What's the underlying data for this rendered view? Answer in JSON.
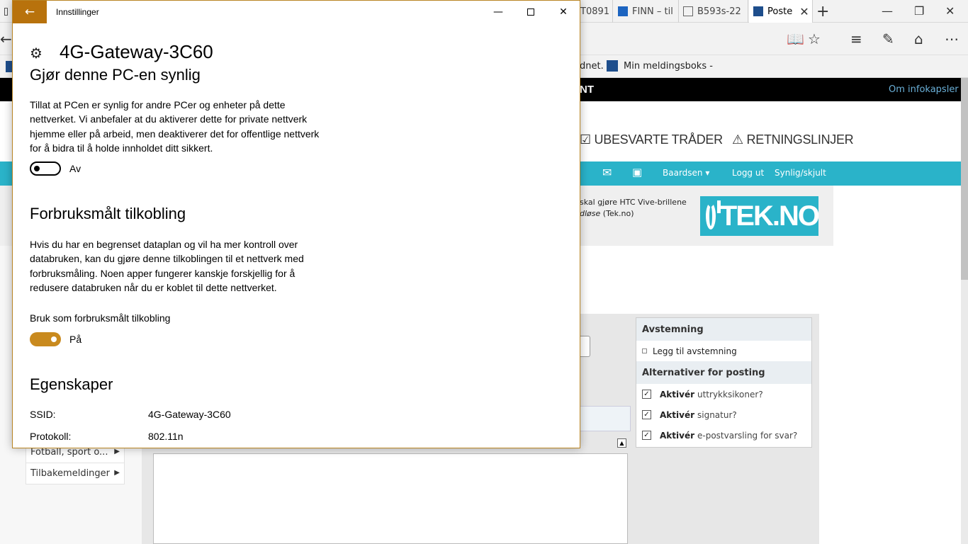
{
  "browser": {
    "tabs": [
      {
        "label": "T0891"
      },
      {
        "label": "FINN – til"
      },
      {
        "label": "B593s-22"
      },
      {
        "label": "Poste"
      }
    ],
    "favorites": [
      {
        "label": "dnet."
      },
      {
        "label": "Min meldingsboks -"
      }
    ]
  },
  "page": {
    "blackbar_text": "NT",
    "info_link": "Om infokapsler",
    "header_links": [
      {
        "label": "UBESVARTE TRÅDER"
      },
      {
        "label": "RETNINGSLINJER"
      }
    ],
    "user_menu": "Baardsen",
    "logout": "Logg ut",
    "visibility": "Synlig/skjult",
    "news_line1": "skal gjøre HTC Vive-brillene",
    "news_line2_italic": "dløse",
    "news_line2_rest": " (Tek.no)",
    "logo_text": "TEK.NO",
    "poll_header": "Avstemning",
    "poll_add": "Legg til avstemning",
    "options_header": "Alternativer for posting",
    "options": [
      {
        "bold": "Aktivér",
        "rest": "uttrykksikoner?"
      },
      {
        "bold": "Aktivér",
        "rest": "signatur?"
      },
      {
        "bold": "Aktivér",
        "rest": "e-postvarsling for svar?"
      }
    ],
    "left_nav": [
      {
        "label": "Fotball, sport o..."
      },
      {
        "label": "Tilbakemeldinger"
      }
    ]
  },
  "settings": {
    "window_title": "Innstillinger",
    "network_name": "4G-Gateway-3C60",
    "section1": {
      "heading": "Gjør denne PC-en synlig",
      "text_lines": [
        "Tillat at PCen er synlig for andre PCer og enheter på dette",
        "nettverket. Vi anbefaler at du aktiverer dette for private nettverk",
        "hjemme eller på arbeid, men deaktiverer det for offentlige nettverk",
        "for å bidra til å holde innholdet ditt sikkert."
      ],
      "toggle_state": "Av",
      "toggle_on": false
    },
    "section2": {
      "heading": "Forbruksmålt tilkobling",
      "text_lines": [
        "Hvis du har en begrenset dataplan og vil ha mer kontroll over",
        "databruken, kan du gjøre denne tilkoblingen til et nettverk med",
        "forbruksmåling. Noen apper fungerer kanskje forskjellig for å",
        "redusere databruken når du er koblet til dette nettverket."
      ],
      "toggle_label": "Bruk som forbruksmålt tilkobling",
      "toggle_state": "På",
      "toggle_on": true
    },
    "section3": {
      "heading": "Egenskaper",
      "properties": [
        {
          "key": "SSID:",
          "value": "4G-Gateway-3C60"
        },
        {
          "key": "Protokoll:",
          "value": "802.11n"
        }
      ]
    },
    "accent_color": "#b8720c"
  }
}
